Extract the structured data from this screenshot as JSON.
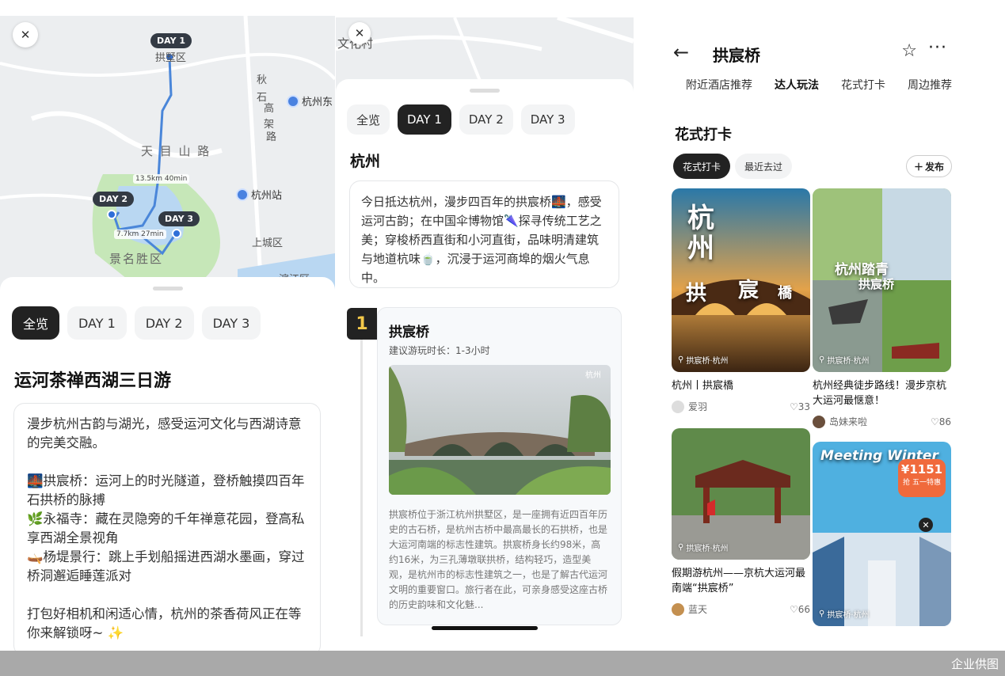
{
  "left": {
    "map": {
      "pins": [
        "DAY 1",
        "DAY 2",
        "DAY 3"
      ],
      "labels": [
        "拱墅区",
        "秋",
        "石",
        "高",
        "架",
        "路",
        "天 目 山 路",
        "景名胜区",
        "上城区",
        "滨江区"
      ],
      "distances": [
        "13.5km 40min",
        "7.7km 27min"
      ],
      "pois": [
        "杭州东",
        "杭州站"
      ]
    },
    "tabs": [
      "全览",
      "DAY 1",
      "DAY 2",
      "DAY 3"
    ],
    "active_tab": "全览",
    "title": "运河茶禅西湖三日游",
    "intro": "漫步杭州古韵与湖光，感受运河文化与西湖诗意的完美交融。",
    "items": [
      "🌉拱宸桥：运河上的时光隧道，登桥触摸四百年石拱桥的脉搏",
      "🌿永福寺：藏在灵隐旁的千年禅意花园，登高私享西湖全景视角",
      "🛶杨堤景行：跳上手划船摇进西湖水墨画，穿过桥洞邂逅睡莲派对"
    ],
    "outro": "打包好相机和闲适心情，杭州的茶香荷风正在等你来解锁呀~ ✨"
  },
  "middle": {
    "map_label": "文化村",
    "tabs": [
      "全览",
      "DAY 1",
      "DAY 2",
      "DAY 3"
    ],
    "active_tab": "DAY 1",
    "city": "杭州",
    "day_intro": "今日抵达杭州，漫步四百年的拱宸桥🌉，感受运河古韵；在中国伞博物馆🌂探寻传统工艺之美；穿梭桥西直街和小河直街，品味明清建筑与地道杭味🍵，沉浸于运河商埠的烟火气息中。",
    "spot": {
      "index": "1",
      "name": "拱宸桥",
      "duration": "建议游玩时长：1-3小时",
      "watermark": "杭州",
      "description": "拱宸桥位于浙江杭州拱墅区，是一座拥有近四百年历史的古石桥，是杭州古桥中最高最长的石拱桥，也是大运河南端的标志性建筑。拱宸桥身长约98米，高约16米，为三孔薄墩联拱桥，结构轻巧，造型美观，是杭州市的标志性建筑之一，也是了解古代运河文明的重要窗口。旅行者在此，可亲身感受这座古桥的历史韵味和文化魅..."
    }
  },
  "right": {
    "title": "拱宸桥",
    "subtabs": [
      "附近酒店推荐",
      "达人玩法",
      "花式打卡",
      "周边推荐"
    ],
    "active_subtab": "达人玩法",
    "section_title": "花式打卡",
    "chips": [
      "花式打卡",
      "最近去过"
    ],
    "publish": "发布",
    "notes": [
      {
        "title": "杭州丨拱宸橋",
        "author": "爱羽",
        "likes": "33",
        "location": "拱宸桥·杭州",
        "overlay": [
          "杭",
          "州",
          "拱",
          "宸",
          "橋"
        ]
      },
      {
        "title": "杭州经典徒步路线！漫步京杭大运河最惬意！",
        "author": "岛妹来啦",
        "likes": "86",
        "location": "拱宸桥·杭州",
        "overlay": [
          "杭州踏青",
          "拱宸桥"
        ]
      },
      {
        "title": "假期游杭州——京杭大运河最南端“拱宸桥”",
        "author": "蓝天",
        "likes": "66",
        "location": "拱宸桥·杭州",
        "overlay": []
      },
      {
        "title": "",
        "author": "",
        "likes": "",
        "location": "拱宸桥·杭州",
        "overlay": [
          "Meeting Winter",
          "¥1151",
          "抢",
          "五一特惠"
        ]
      }
    ]
  },
  "footer": "企业供图"
}
